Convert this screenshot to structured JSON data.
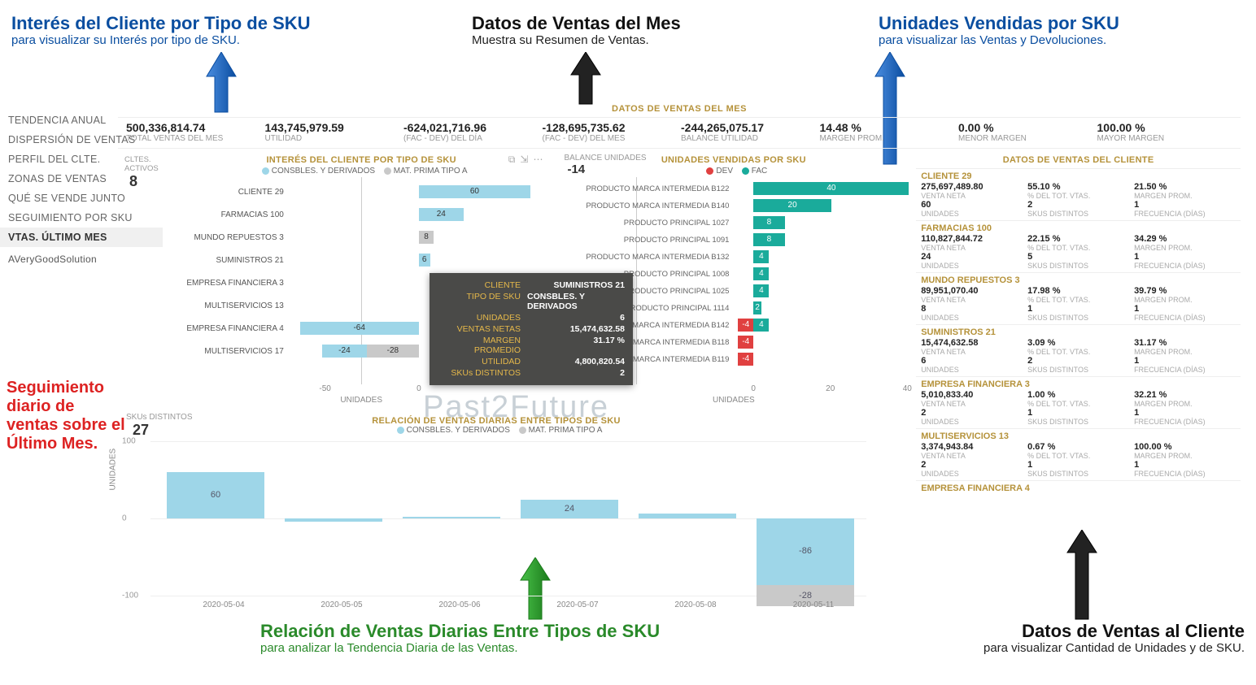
{
  "callouts": {
    "c1_title": "Interés del Cliente por Tipo de SKU",
    "c1_sub": "para visualizar su Interés por tipo de SKU.",
    "c2_title": "Datos de Ventas del Mes",
    "c2_sub": "Muestra su Resumen de Ventas.",
    "c3_title": "Unidades Vendidas por SKU",
    "c3_sub": "para visualizar las Ventas y Devoluciones.",
    "c4_title": "Seguimiento diario de ventas sobre el Último Mes.",
    "c5_title": "Relación de Ventas Diarias Entre Tipos de SKU",
    "c5_sub": "para analizar la Tendencia Diaria de las Ventas.",
    "c6_title": "Datos de Ventas al Cliente",
    "c6_sub": "para visualizar Cantidad de Unidades y de SKU."
  },
  "nav": {
    "items": [
      "TENDENCIA ANUAL",
      "DISPERSIÓN DE VENTAS",
      "PERFIL DEL CLTE.",
      "ZONAS DE VENTAS",
      "QUÉ SE VENDE JUNTO",
      "SEGUIMIENTO POR SKU",
      "VTAS. ÚLTIMO MES"
    ],
    "brand": "AVeryGoodSolution"
  },
  "kpis_title": "DATOS DE VENTAS DEL MES",
  "kpis": [
    {
      "val": "500,336,814.74",
      "lbl": "TOTAL VENTAS DEL MES"
    },
    {
      "val": "143,745,979.59",
      "lbl": "UTILIDAD"
    },
    {
      "val": "-624,021,716.96",
      "lbl": "(FAC - DEV) DEL DÍA"
    },
    {
      "val": "-128,695,735.62",
      "lbl": "(FAC - DEV) DEL MES"
    },
    {
      "val": "-244,265,075.17",
      "lbl": "BALANCE UTILIDAD"
    },
    {
      "val": "14.48 %",
      "lbl": "MARGEN PROM."
    },
    {
      "val": "0.00 %",
      "lbl": "MENOR MARGEN"
    },
    {
      "val": "100.00 %",
      "lbl": "MAYOR MARGEN"
    }
  ],
  "cltes": {
    "lbl": "CLTES. ACTIVOS",
    "val": "8"
  },
  "chartA": {
    "title": "INTERÉS DEL CLIENTE POR TIPO DE SKU",
    "legend1": "CONSBLES. Y DERIVADOS",
    "legend2": "MAT. PRIMA TIPO A",
    "axis_label": "UNIDADES",
    "ticks": [
      "-50",
      "0"
    ]
  },
  "chart_data": [
    {
      "type": "bar",
      "id": "chartA_interes_cliente",
      "categories": [
        "CLIENTE 29",
        "FARMACIAS 100",
        "MUNDO REPUESTOS 3",
        "SUMINISTROS 21",
        "EMPRESA FINANCIERA 3",
        "MULTISERVICIOS 13",
        "EMPRESA FINANCIERA 4",
        "MULTISERVICIOS 17"
      ],
      "series": [
        {
          "name": "CONSBLES. Y DERIVADOS",
          "values": [
            60,
            24,
            null,
            6,
            null,
            null,
            -64,
            -24
          ]
        },
        {
          "name": "MAT. PRIMA TIPO A",
          "values": [
            null,
            null,
            8,
            null,
            null,
            null,
            null,
            -28
          ]
        }
      ],
      "xlabel": "UNIDADES",
      "xlim": [
        -70,
        70
      ]
    },
    {
      "type": "bar",
      "id": "chartB_unidades_sku",
      "categories": [
        "PRODUCTO MARCA INTERMEDIA B122",
        "PRODUCTO MARCA INTERMEDIA B140",
        "PRODUCTO PRINCIPAL 1027",
        "PRODUCTO PRINCIPAL 1091",
        "PRODUCTO MARCA INTERMEDIA B132",
        "PRODUCTO PRINCIPAL 1008",
        "PRODUCTO PRINCIPAL 1025",
        "PRODUCTO PRINCIPAL 1114",
        "PRODUCTO MARCA INTERMEDIA B142",
        "PRODUCTO MARCA INTERMEDIA B118",
        "PRODUCTO MARCA INTERMEDIA B119"
      ],
      "series": [
        {
          "name": "FAC",
          "values": [
            40,
            20,
            8,
            8,
            4,
            4,
            4,
            2,
            4,
            null,
            null
          ]
        },
        {
          "name": "DEV",
          "values": [
            null,
            null,
            null,
            null,
            null,
            null,
            null,
            null,
            -4,
            -4,
            -4
          ]
        }
      ],
      "xlabel": "UNIDADES",
      "xlim": [
        -5,
        40
      ]
    },
    {
      "type": "bar",
      "id": "daily_relacion",
      "categories": [
        "2020-05-04",
        "2020-05-05",
        "2020-05-06",
        "2020-05-07",
        "2020-05-08",
        "2020-05-11"
      ],
      "series": [
        {
          "name": "CONSBLES. Y DERIVADOS",
          "values": [
            60,
            -4,
            2,
            24,
            6,
            -86
          ]
        },
        {
          "name": "MAT. PRIMA TIPO A",
          "values": [
            null,
            null,
            null,
            null,
            null,
            -28
          ]
        }
      ],
      "ylabel": "UNIDADES",
      "ylim": [
        -100,
        100
      ]
    }
  ],
  "tooltip": {
    "rows": [
      {
        "k": "CLIENTE",
        "v": "SUMINISTROS 21"
      },
      {
        "k": "TIPO DE SKU",
        "v": "CONSBLES. Y DERIVADOS"
      },
      {
        "k": "UNIDADES",
        "v": "6"
      },
      {
        "k": "VENTAS NETAS",
        "v": "15,474,632.58"
      },
      {
        "k": "MARGEN PROMEDIO",
        "v": "31.17 %"
      },
      {
        "k": "UTILIDAD",
        "v": "4,800,820.54"
      },
      {
        "k": "SKUs DISTINTOS",
        "v": "2"
      }
    ]
  },
  "chartB": {
    "title": "UNIDADES VENDIDAS POR SKU",
    "bal_lbl": "BALANCE UNIDADES",
    "bal_val": "-14",
    "legend_dev": "DEV",
    "legend_fac": "FAC",
    "axis_label": "UNIDADES",
    "ticks": [
      "0",
      "20",
      "40"
    ]
  },
  "custpanel": {
    "title": "DATOS DE VENTAS DEL CLIENTE",
    "labels": {
      "vn": "VENTA NETA",
      "pt": "% DEL TOT. VTAS.",
      "mp": "MARGEN PROM.",
      "un": "UNIDADES",
      "sd": "SKUs DISTINTOS",
      "fd": "FRECUENCIA (DÍAS)"
    },
    "customers": [
      {
        "name": "CLIENTE 29",
        "vn": "275,697,489.80",
        "pt": "55.10 %",
        "mp": "21.50 %",
        "un": "60",
        "sd": "2",
        "fd": "1"
      },
      {
        "name": "FARMACIAS 100",
        "vn": "110,827,844.72",
        "pt": "22.15 %",
        "mp": "34.29 %",
        "un": "24",
        "sd": "5",
        "fd": "1"
      },
      {
        "name": "MUNDO REPUESTOS 3",
        "vn": "89,951,070.40",
        "pt": "17.98 %",
        "mp": "39.79 %",
        "un": "8",
        "sd": "1",
        "fd": "1"
      },
      {
        "name": "SUMINISTROS 21",
        "vn": "15,474,632.58",
        "pt": "3.09 %",
        "mp": "31.17 %",
        "un": "6",
        "sd": "2",
        "fd": "1"
      },
      {
        "name": "EMPRESA FINANCIERA 3",
        "vn": "5,010,833.40",
        "pt": "1.00 %",
        "mp": "32.21 %",
        "un": "2",
        "sd": "1",
        "fd": "1"
      },
      {
        "name": "MULTISERVICIOS 13",
        "vn": "3,374,943.84",
        "pt": "0.67 %",
        "mp": "100.00 %",
        "un": "2",
        "sd": "1",
        "fd": "1"
      },
      {
        "name": "EMPRESA FINANCIERA 4"
      }
    ]
  },
  "daily": {
    "skud_lbl": "SKUs DISTINTOS",
    "skud_val": "27",
    "title": "RELACIÓN DE VENTAS DIARIAS ENTRE TIPOS DE SKU",
    "legend1": "CONSBLES. Y DERIVADOS",
    "legend2": "MAT. PRIMA TIPO A",
    "ylabel": "UNIDADES",
    "yticks": [
      "100",
      "0",
      "-100"
    ]
  },
  "watermark": "Past2Future"
}
